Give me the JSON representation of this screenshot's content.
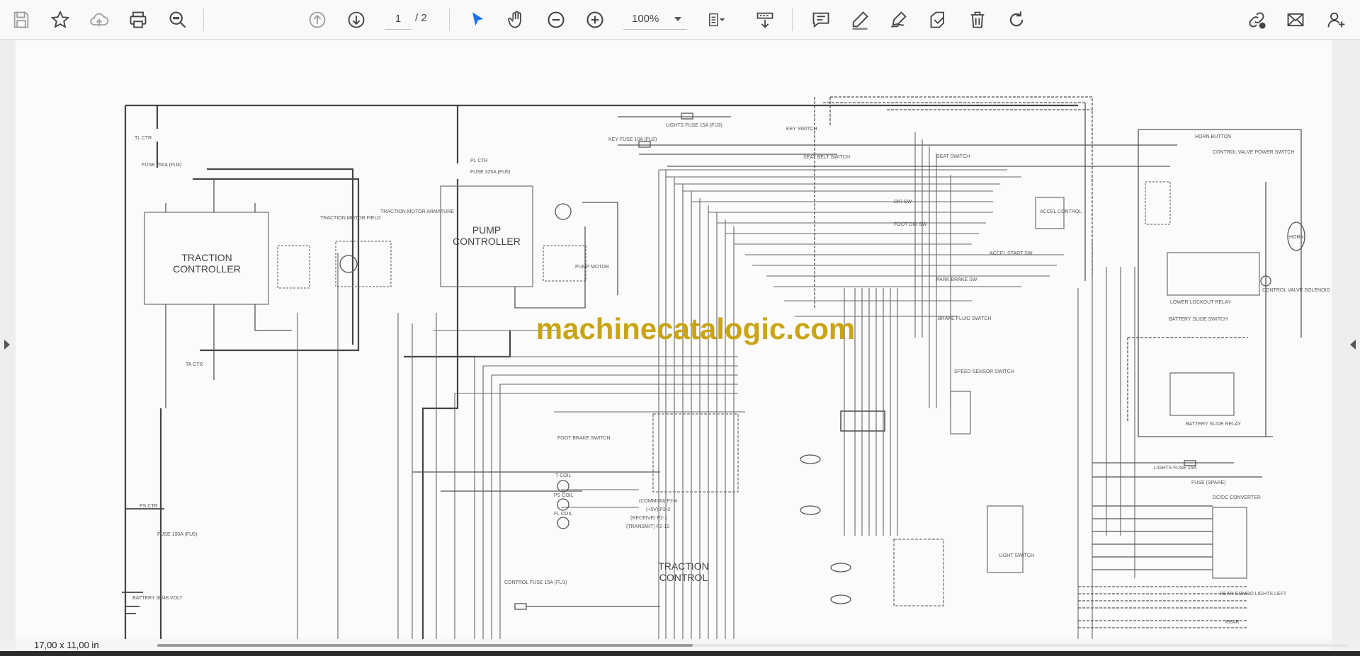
{
  "toolbar": {
    "page_current": "1",
    "page_total": "/ 2",
    "zoom": "100%",
    "icons": [
      "save-icon",
      "bookmark-star-icon",
      "upload-cloud-icon",
      "print-icon",
      "find-zoom-icon",
      "previous-page-icon",
      "next-page-icon",
      "select-cursor-icon",
      "hand-pan-icon",
      "zoom-out-icon",
      "zoom-in-icon",
      "fit-page-icon",
      "page-layout-icon",
      "comment-icon",
      "highlight-pen-icon",
      "draw-signature-icon",
      "stamp-icon",
      "delete-icon",
      "rotate-icon",
      "share-link-icon",
      "email-icon",
      "add-user-icon"
    ],
    "accent_color": "#1a73e8"
  },
  "document": {
    "watermark": "machinecatalogic.com",
    "watermark_color": "#c9a414",
    "labels": {
      "traction_controller_1": "TRACTION",
      "traction_controller_2": "CONTROLLER",
      "pump_controller_1": "PUMP",
      "pump_controller_2": "CONTROLLER",
      "traction_control_1": "TRACTION",
      "traction_control_2": "CONTROL",
      "lights_fuse": "LIGHTS FUSE 15A (FU3)",
      "key_fuse": "KEY FUSE 10A (FU2)",
      "key_switch": "KEY SWITCH",
      "seat_belt_switch": "SEAT BELT SWITCH",
      "seat_switch": "SEAT SWITCH",
      "horn_button": "HORN BUTTON",
      "control_valve_power_switch": "CONTROL VALVE POWER SWITCH",
      "dir_sw": "DIR SW",
      "accel_control": "ACCEL CONTROL",
      "foot_dir_sw": "FOOT DIR SW",
      "accel_start_sw": "ACCEL START SW",
      "lower_lockout_relay": "LOWER LOCKOUT RELAY",
      "battery_slide_switch": "BATTERY SLIDE SWITCH",
      "battery_slide_relay": "BATTERY SLIDE RELAY",
      "control_valve_solenoid": "CONTROL VALVE SOLENOID",
      "horn": "HORN",
      "park_brake_sw": "PARK BRAKE SW",
      "brake_fluid_switch": "BRAKE FLUID SWITCH",
      "speed_sensor_switch": "SPEED SENSOR SWITCH",
      "foot_brake_switch": "FOOT BRAKE SWITCH",
      "t_coil": "T COIL",
      "ps_coil": "PS COIL",
      "fl_coil": "FL COIL",
      "control_fuse": "CONTROL FUSE 15A (FU1)",
      "ps_ctr": "PS CTR",
      "fuse_100a": "FUSE 100A (FU5)",
      "battery": "BATTERY 36/48 VOLT",
      "fuse_750a": "FUSE 750A (FU4)",
      "tl_ctr": "TL CTR",
      "ta_ctr": "TA CTR",
      "pl_ctr": "PL CTR",
      "fuse_325a": "FUSE 325A (FU6)",
      "traction_motor_field": "TRACTION MOTOR FIELD",
      "traction_motor_armature": "TRACTION MOTOR ARMATURE",
      "pump_motor": "PUMP MOTOR",
      "lights_fuse_15a": "LIGHTS FUSE 15A",
      "fuse_spare": "FUSE (SPARE)",
      "dc_dc_converter": "DC/DC CONVERTER",
      "light_switch": "LIGHT SWITCH",
      "rear_combo_lights_left": "REAR COMBO LIGHTS LEFT",
      "rear": "REAR",
      "common": "(COMMON) P2-4",
      "plus5v": "(+5V) P2-3",
      "receive": "(RECEIVE) P2-1",
      "transmit": "(TRANSMIT) P2-12"
    }
  },
  "status": {
    "page_size": "17,00 x 11,00 in",
    "scroll_fraction": 0.45
  }
}
